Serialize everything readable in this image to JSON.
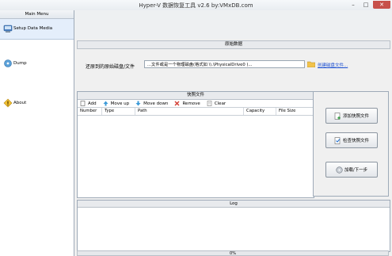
{
  "window": {
    "title": "Hyper-V 数据恢复工具 v2.6 by:VMxDB.com",
    "minimize_glyph": "–",
    "maximize_glyph": "□",
    "close_glyph": "✕"
  },
  "menu": {
    "header": "Main Menu",
    "items": [
      {
        "label": "Setup Data Media",
        "icon": "disk-setup-icon",
        "active": true
      },
      {
        "label": "Dump",
        "icon": "dump-icon",
        "active": false
      },
      {
        "label": "About",
        "icon": "about-icon",
        "active": false
      }
    ]
  },
  "source": {
    "group_title": "原始数据",
    "label": "还原到的原始磁盘/文件",
    "input_value": "...文件或是一个物理磁盘(格式如 \\\\.\\PhysicalDrive0 )...",
    "create_link": "创建磁盘文件..."
  },
  "snapshots": {
    "title": "快照文件",
    "toolbar": {
      "add": "Add",
      "move_up": "Move up",
      "move_down": "Move down",
      "remove": "Remove",
      "clear": "Clear"
    },
    "columns": [
      "Number",
      "Type",
      "Path",
      "Capacity",
      "File Size"
    ],
    "rows": []
  },
  "actions": {
    "add_snapshot": "添加快照文件",
    "check_snapshot": "检查快照文件",
    "load_next": "加载/下一步"
  },
  "log": {
    "title": "Log"
  },
  "progress": {
    "value": 0,
    "text": "0%"
  },
  "colors": {
    "accent": "#1b4fd1",
    "close_button": "#c7504a",
    "progress_fill": "#3fb34f"
  }
}
